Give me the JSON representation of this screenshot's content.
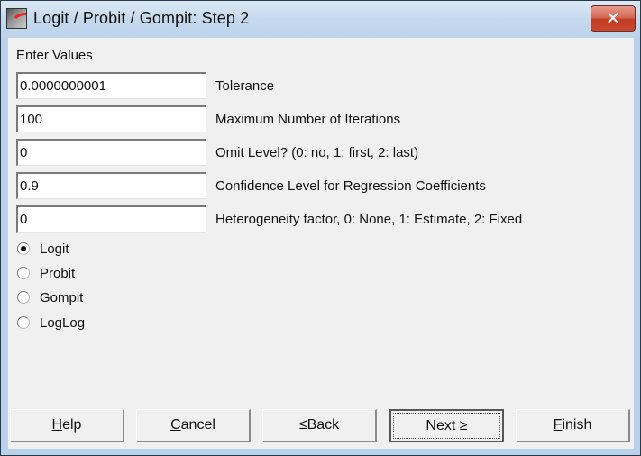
{
  "window": {
    "title": "Logit / Probit / Gompit: Step 2",
    "app_icon": "logit-curve-icon",
    "close_glyph": "✕"
  },
  "section": {
    "label": "Enter Values"
  },
  "fields": [
    {
      "value": "0.0000000001",
      "label": "Tolerance"
    },
    {
      "value": "100",
      "label": "Maximum Number of Iterations"
    },
    {
      "value": "0",
      "label": "Omit Level? (0: no, 1: first, 2: last)"
    },
    {
      "value": "0.9",
      "label": "Confidence Level for Regression Coefficients"
    },
    {
      "value": "0",
      "label": "Heterogeneity factor, 0: None, 1: Estimate, 2: Fixed"
    }
  ],
  "model_options": [
    {
      "label": "Logit",
      "selected": true
    },
    {
      "label": "Probit",
      "selected": false
    },
    {
      "label": "Gompit",
      "selected": false
    },
    {
      "label": "LogLog",
      "selected": false
    }
  ],
  "buttons": {
    "help": {
      "accel": "H",
      "rest": "elp"
    },
    "cancel": {
      "accel": "C",
      "rest": "ancel"
    },
    "back": {
      "accel": "<",
      "rest": " Back",
      "accel_glyph": "≤"
    },
    "next": {
      "prefix": "Next ",
      "accel_glyph": "≥"
    },
    "finish": {
      "accel": "F",
      "rest": "inish"
    }
  }
}
